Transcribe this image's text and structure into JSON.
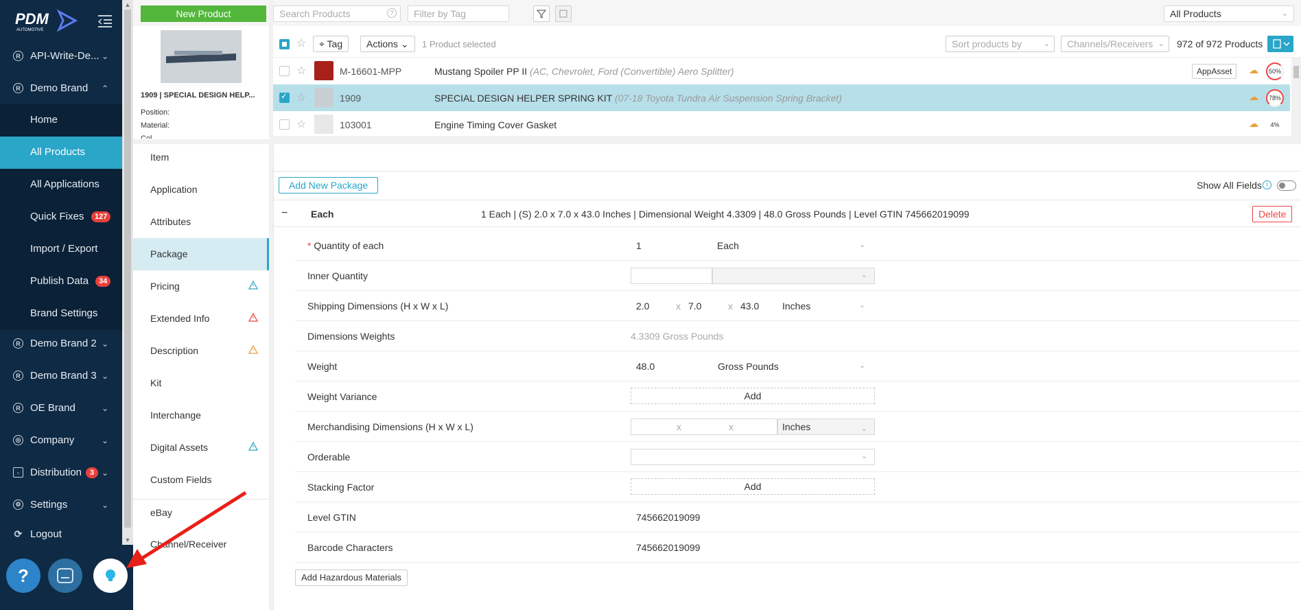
{
  "app": {
    "logo_text": "PDM",
    "logo_sub": "AUTOMOTIVE"
  },
  "sidebar": {
    "items": [
      {
        "label": "API-Write-De...",
        "icon": "registered-icon"
      },
      {
        "label": "Demo Brand",
        "icon": "registered-icon"
      }
    ],
    "sub_items": [
      {
        "label": "Home"
      },
      {
        "label": "All Products"
      },
      {
        "label": "All Applications"
      },
      {
        "label": "Quick Fixes",
        "badge": "127"
      },
      {
        "label": "Import / Export"
      },
      {
        "label": "Publish Data",
        "badge": "34"
      },
      {
        "label": "Brand Settings"
      }
    ],
    "bottom_items": [
      {
        "label": "Demo Brand 2"
      },
      {
        "label": "Demo Brand 3"
      },
      {
        "label": "OE Brand"
      },
      {
        "label": "Company"
      },
      {
        "label": "Distribution",
        "badge": "3"
      },
      {
        "label": "Settings"
      },
      {
        "label": "Logout"
      }
    ],
    "help_label": "?"
  },
  "topbar": {
    "new_product": "New Product",
    "search_placeholder": "Search Products",
    "tag_placeholder": "Filter by Tag",
    "view_select": "All Products"
  },
  "list_toolbar": {
    "tag": "Tag",
    "actions": "Actions",
    "selected_text": "1 Product selected",
    "sort": "Sort products by",
    "channels": "Channels/Receivers",
    "count": "972 of 972 Products"
  },
  "products": [
    {
      "sku": "M-16601-MPP",
      "desc": "Mustang Spoiler PP II",
      "note": "(AC, Chevrolet, Ford (Convertible) Aero Splitter)",
      "tag": "AppAsset",
      "pct": "50%",
      "selected": false
    },
    {
      "sku": "1909",
      "desc": "SPECIAL DESIGN HELPER SPRING KIT",
      "note": "(07-18 Toyota Tundra Air Suspension Spring Bracket)",
      "tag": "",
      "pct": "78%",
      "selected": true
    },
    {
      "sku": "103001",
      "desc": "Engine Timing Cover Gasket",
      "note": "",
      "tag": "",
      "pct": "4%",
      "selected": false
    }
  ],
  "product_card": {
    "title": "1909 | SPECIAL DESIGN HELP...",
    "position": "Position:",
    "material": "Material:",
    "color": "Col..."
  },
  "nav": [
    {
      "label": "Item"
    },
    {
      "label": "Application"
    },
    {
      "label": "Attributes"
    },
    {
      "label": "Package"
    },
    {
      "label": "Pricing",
      "warn": "blue"
    },
    {
      "label": "Extended Info",
      "warn": "red"
    },
    {
      "label": "Description",
      "warn": "orange"
    },
    {
      "label": "Kit"
    },
    {
      "label": "Interchange"
    },
    {
      "label": "Digital Assets",
      "warn": "blue"
    },
    {
      "label": "Custom Fields"
    },
    {
      "label": "eBay"
    },
    {
      "label": "Channel/Receiver"
    }
  ],
  "package": {
    "add_new": "Add New Package",
    "show_all": "Show All Fields",
    "header_name": "Each",
    "header_summary": "1 Each | (S) 2.0 x 7.0 x 43.0 Inches | Dimensional Weight 4.3309 | 48.0 Gross Pounds | Level GTIN 745662019099",
    "delete": "Delete",
    "fields": {
      "qty_label": "Quantity of each",
      "qty_value": "1",
      "qty_unit": "Each",
      "inner_label": "Inner Quantity",
      "ship_label": "Shipping Dimensions (H x W x L)",
      "ship_h": "2.0",
      "ship_w": "7.0",
      "ship_l": "43.0",
      "ship_unit": "Inches",
      "x": "x",
      "dimw_label": "Dimensions Weights",
      "dimw_value": "4.3309 Gross Pounds",
      "weight_label": "Weight",
      "weight_value": "48.0",
      "weight_unit": "Gross Pounds",
      "variance_label": "Weight Variance",
      "add": "Add",
      "merch_label": "Merchandising Dimensions (H x W x L)",
      "merch_unit": "Inches",
      "orderable_label": "Orderable",
      "stacking_label": "Stacking Factor",
      "gtin_label": "Level GTIN",
      "gtin_value": "745662019099",
      "barcode_label": "Barcode Characters",
      "barcode_value": "745662019099",
      "required": "*"
    },
    "hazmat": "Add Hazardous Materials"
  }
}
